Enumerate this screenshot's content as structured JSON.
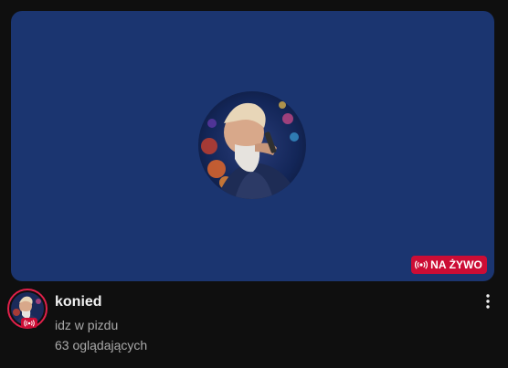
{
  "thumbnail": {
    "background_color": "#1b3570",
    "live_badge_label": "NA ŻYWO",
    "badge_color": "#cc0d35",
    "avatar_icon": "channel-photo"
  },
  "video": {
    "title": "konied",
    "channel_line": "idz w pizdu",
    "viewers": "63 oglądających",
    "menu_icon": "more-vert-icon"
  }
}
